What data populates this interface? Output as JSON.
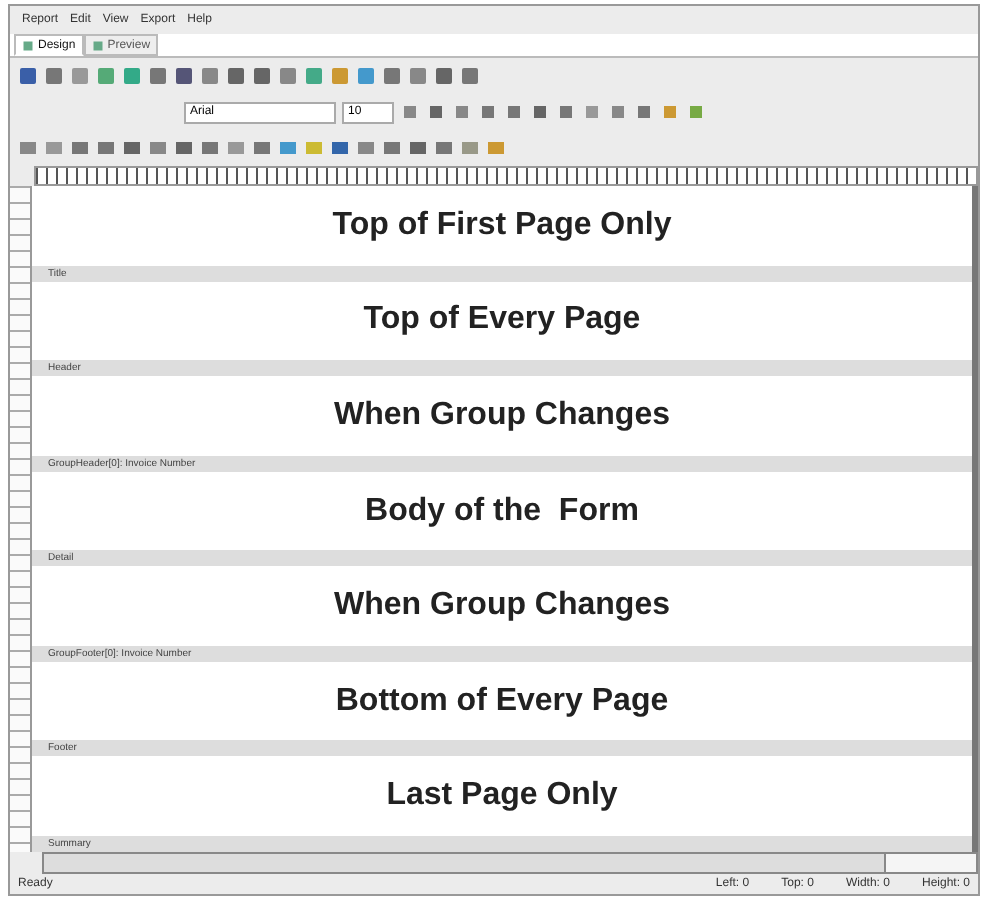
{
  "menu": [
    "Report",
    "Edit",
    "View",
    "Export",
    "Help"
  ],
  "tabs": [
    {
      "label": "Design",
      "selected": true
    },
    {
      "label": "Preview",
      "selected": false
    }
  ],
  "font_field": {
    "value": "Arial"
  },
  "size_field": {
    "value": "10"
  },
  "bands": [
    {
      "content": "Top of First Page Only",
      "label": "Title"
    },
    {
      "content": "Top of Every Page",
      "label": "Header"
    },
    {
      "content": "When Group Changes",
      "label": "GroupHeader[0]: Invoice Number"
    },
    {
      "content": "Body of the  Form",
      "label": "Detail"
    },
    {
      "content": "When Group Changes",
      "label": "GroupFooter[0]: Invoice Number"
    },
    {
      "content": "Bottom of Every Page",
      "label": "Footer"
    },
    {
      "content": "Last Page Only",
      "label": "Summary"
    }
  ],
  "status_bar": {
    "message": "Ready",
    "fields": [
      "Left: 0",
      "Top: 0",
      "Width: 0",
      "Height: 0"
    ]
  }
}
